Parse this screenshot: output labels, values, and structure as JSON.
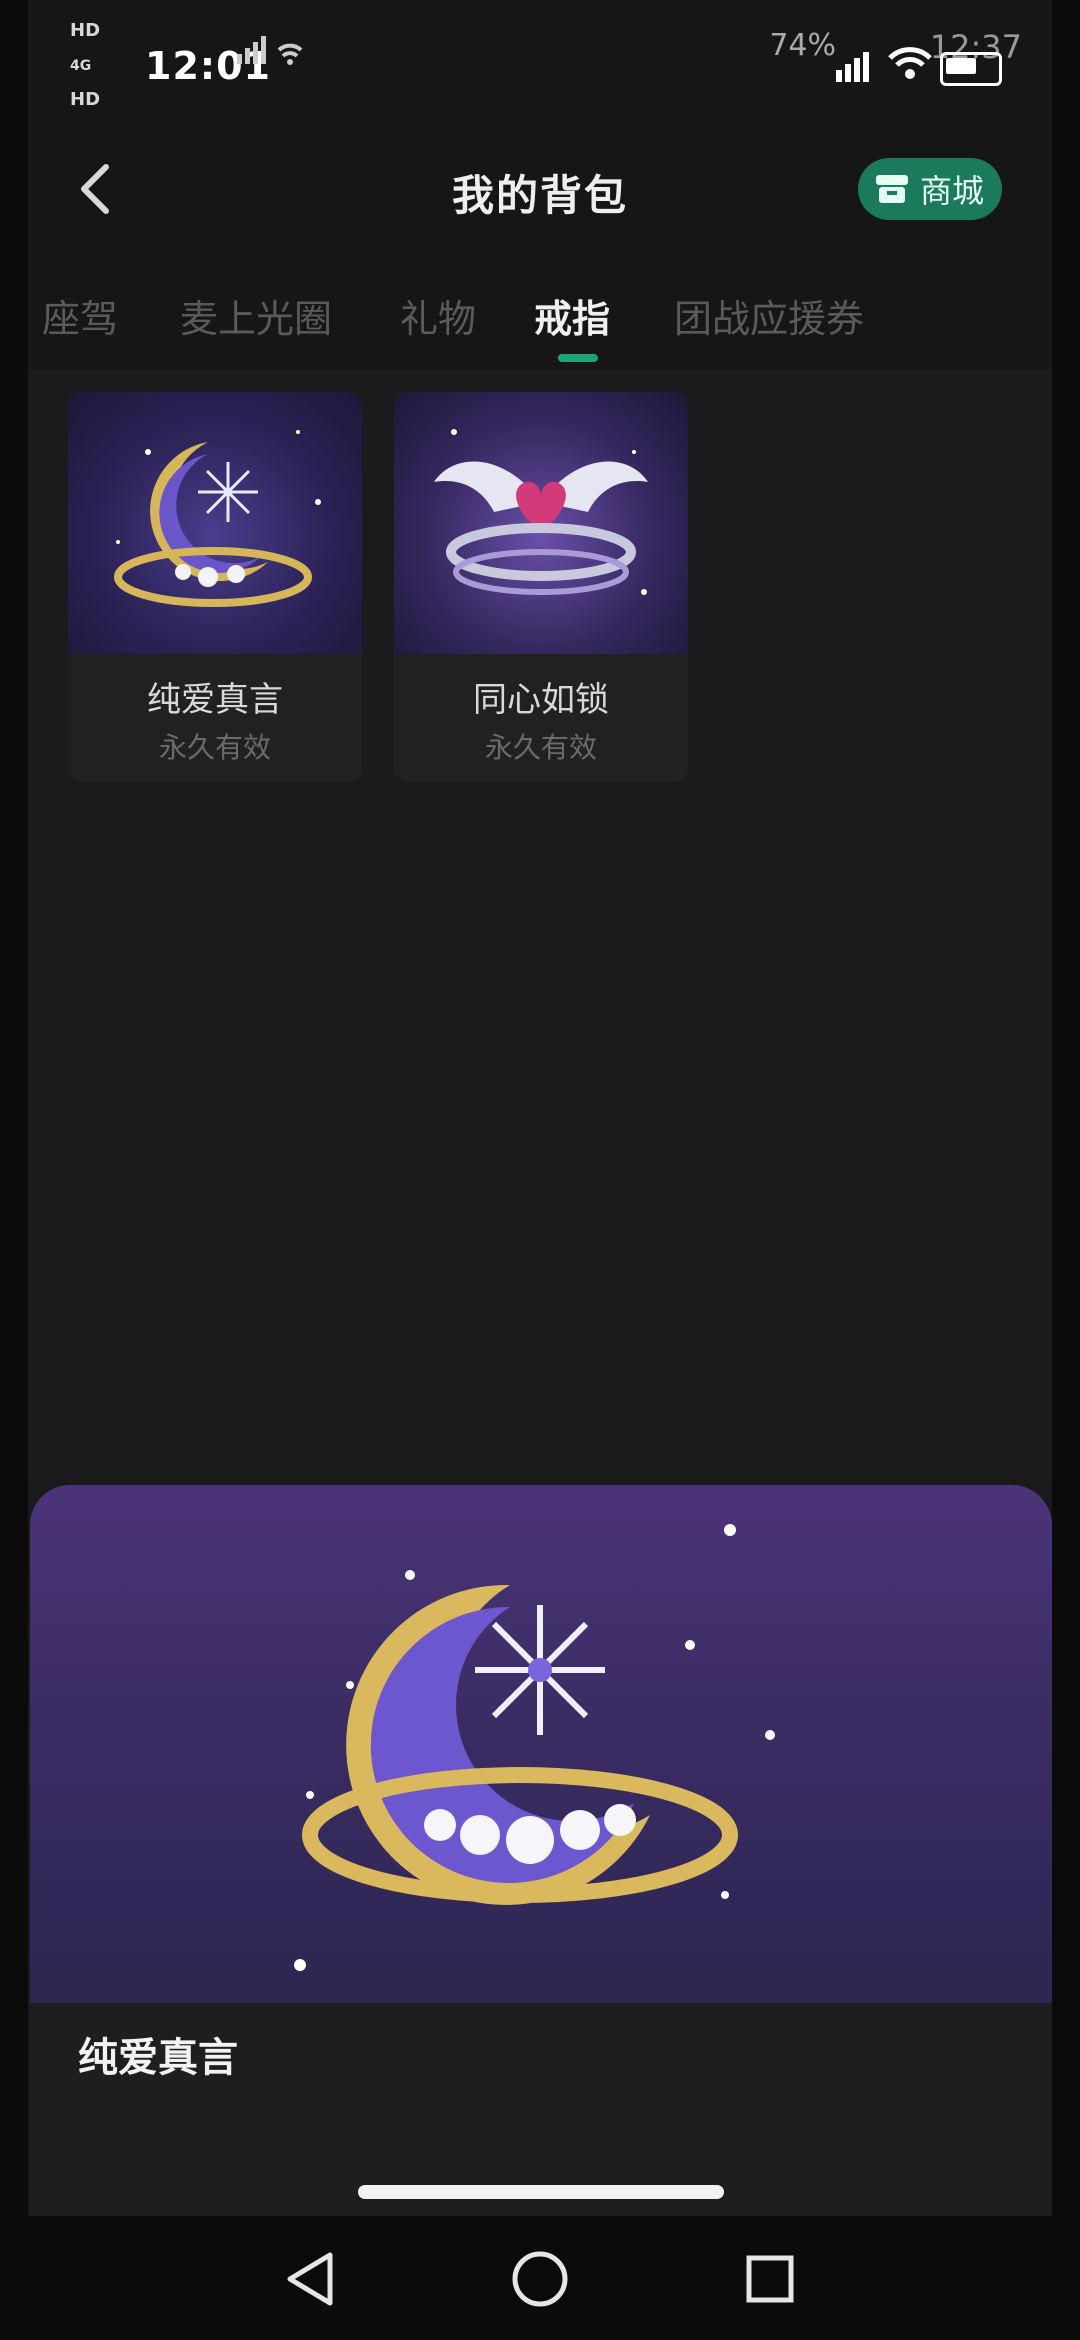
{
  "status_bar": {
    "hd1": "HD",
    "hd2": "HD",
    "net1": "4G",
    "net2": "4G",
    "time": "12:01",
    "battery_pct": "74%",
    "time_right": "12:37"
  },
  "header": {
    "title": "我的背包",
    "shop_label": "商城"
  },
  "tabs": [
    {
      "label": "座驾",
      "active": false
    },
    {
      "label": "麦上光圈",
      "active": false
    },
    {
      "label": "礼物",
      "active": false
    },
    {
      "label": "戒指",
      "active": true
    },
    {
      "label": "团战应援券",
      "active": false
    }
  ],
  "items": [
    {
      "name": "纯爱真言",
      "validity": "永久有效"
    },
    {
      "name": "同心如锁",
      "validity": "永久有效"
    }
  ],
  "preview": {
    "name": "纯爱真言"
  },
  "colors": {
    "accent": "#1ea47a",
    "shop_bg": "#1a7a5b",
    "sheet_top": "#4b3478"
  },
  "icons": {
    "back": "chevron-left-icon",
    "shop": "store-icon",
    "nav_back": "triangle-back-icon",
    "nav_home": "circle-home-icon",
    "nav_recents": "square-recents-icon"
  }
}
